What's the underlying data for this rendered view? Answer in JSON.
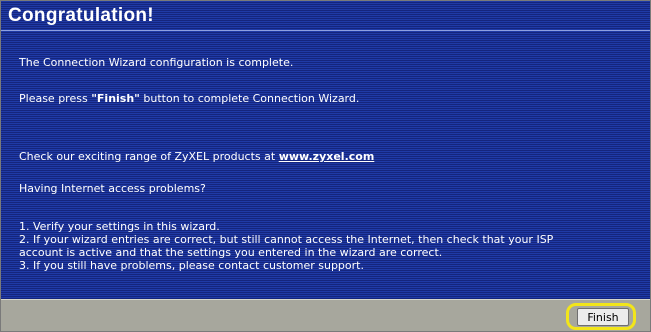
{
  "header": {
    "title": "Congratulation!"
  },
  "content": {
    "line1": "The Connection Wizard configuration is complete.",
    "line2_prefix": "Please press ",
    "line2_bold": "\"Finish\"",
    "line2_suffix": " button to complete Connection Wizard.",
    "line3_prefix": "Check our exciting range of ZyXEL products at ",
    "line3_link": "www.zyxel.com",
    "line4": "Having Internet access problems?",
    "tips": [
      "1. Verify your settings in this wizard.",
      "2. If your wizard entries are correct, but still cannot access the Internet, then check that your ISP",
      "account is active and that the settings you entered in the wizard are correct.",
      "3. If you still have problems, please contact customer support."
    ]
  },
  "footer": {
    "finish_label": "Finish",
    "highlight_color": "#f2e51a"
  },
  "colors": {
    "panel_background": "#1c2f93",
    "footer_background": "#a7a79d",
    "text": "#ffffff"
  }
}
